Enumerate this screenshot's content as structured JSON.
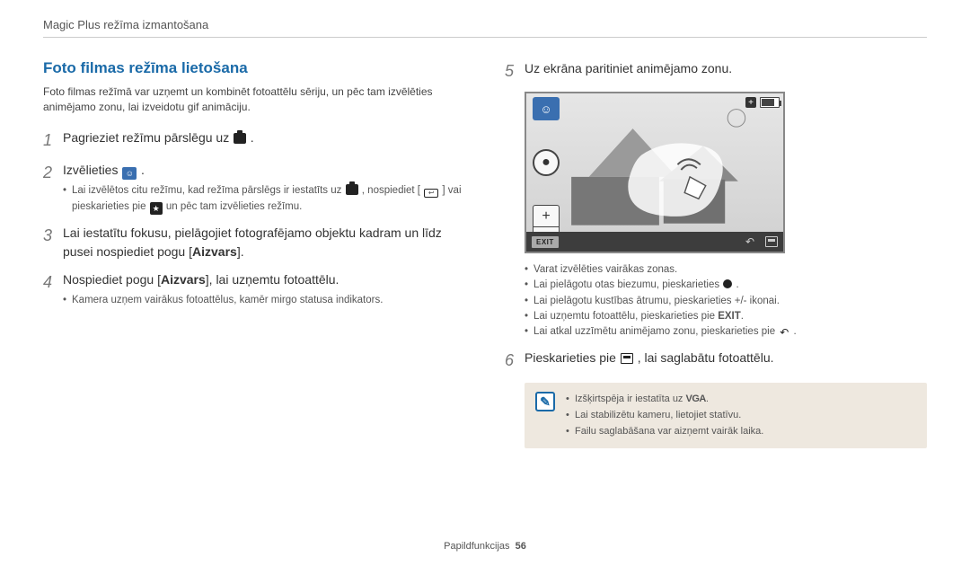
{
  "breadcrumb": "Magic Plus režīma izmantošana",
  "section_title": "Foto filmas režīma lietošana",
  "intro": "Foto filmas režīmā var uzņemt un kombinēt fotoattēlu sēriju, un pēc tam izvēlēties animējamo zonu, lai izveidotu gif animāciju.",
  "step1_num": "1",
  "step1_text": "Pagrieziet režīmu pārslēgu uz ",
  "step1_suffix": " .",
  "step2_num": "2",
  "step2_text": "Izvēlieties ",
  "step2_suffix": " .",
  "step2_b1a": "Lai izvēlētos citu režīmu, kad režīma pārslēgs ir iestatīts uz ",
  "step2_b1b": " , nospiediet [",
  "step2_b1c": "] vai pieskarieties pie ",
  "step2_b1d": " un pēc tam izvēlieties režīmu.",
  "step3_num": "3",
  "step3_text_a": "Lai iestatītu fokusu, pielāgojiet fotografējamo objektu kadram un līdz pusei nospiediet pogu [",
  "step3_bold": "Aizvars",
  "step3_text_b": "].",
  "step4_num": "4",
  "step4_text_a": "Nospiediet pogu [",
  "step4_bold": "Aizvars",
  "step4_text_b": "], lai uzņemtu fotoattēlu.",
  "step4_b1": "Kamera uzņem vairākus fotoattēlus, kamēr mirgo statusa indikators.",
  "step5_num": "5",
  "step5_text": "Uz ekrāna paritiniet animējamo zonu.",
  "step5_b1": "Varat izvēlēties vairākas zonas.",
  "step5_b2a": "Lai pielāgotu otas biezumu, pieskarieties ",
  "step5_b2b": ".",
  "step5_b3": "Lai pielāgotu kustības ātrumu, pieskarieties +/- ikonai.",
  "step5_b4a": "Lai uzņemtu fotoattēlu, pieskarieties pie ",
  "step5_b4_exit": "EXIT",
  "step5_b4b": ".",
  "step5_b5a": "Lai atkal uzzīmētu animējamo zonu, pieskarieties pie ",
  "step5_b5b": ".",
  "step6_num": "6",
  "step6_text_a": "Pieskarieties pie ",
  "step6_text_b": ", lai saglabātu fotoattēlu.",
  "note1a": "Izšķirtspēja ir iestatīta uz ",
  "note1_vga": "VGA",
  "note1b": ".",
  "note2": "Lai stabilizētu kameru, lietojiet statīvu.",
  "note3": "Failu saglabāšana var aizņemt vairāk laika.",
  "screen_exit": "EXIT",
  "footer_label": "Papildfunkcijas",
  "footer_page": "56"
}
